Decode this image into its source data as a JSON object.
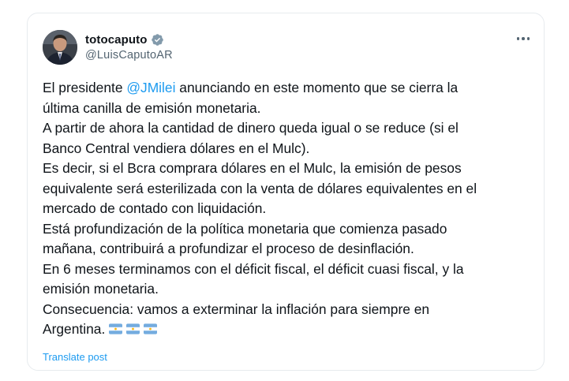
{
  "tweet": {
    "display_name": "totocaputo",
    "handle": "@LuisCaputoAR",
    "verified_badge_icon": "verified-badge-icon",
    "more_icon": "more-options-icon",
    "lines": {
      "l1_pre": "El presidente ",
      "l1_mention": "@JMilei",
      "l1_post": " anunciando en este momento que se cierra la",
      "l2": "última canilla de emisión monetaria.",
      "l3": "A partir de ahora la cantidad de dinero queda igual o se reduce (si el",
      "l4": "Banco Central vendiera dólares en el Mulc).",
      "l5": "Es decir, si el Bcra comprara dólares en el Mulc, la emisión de pesos",
      "l6": "equivalente será esterilizada con la venta de dólares equivalentes en el",
      "l7": "mercado de contado con liquidación.",
      "l8": "Está profundización de la política monetaria que comienza pasado",
      "l9": "mañana, contribuirá a profundizar el proceso de desinflación.",
      "l10": "En 6 meses terminamos con el déficit fiscal, el déficit cuasi fiscal, y la",
      "l11": "emisión monetaria.",
      "l12": "Consecuencia:  vamos a exterminar la inflación para siempre en",
      "l13": "Argentina."
    },
    "flags": [
      "argentina-flag-icon",
      "argentina-flag-icon",
      "argentina-flag-icon"
    ],
    "translate_label": "Translate post"
  },
  "colors": {
    "link": "#1d9bf0",
    "text": "#0f1419",
    "secondary": "#536471",
    "flag_blue": "#74acdf",
    "flag_sun": "#f6b40e"
  }
}
